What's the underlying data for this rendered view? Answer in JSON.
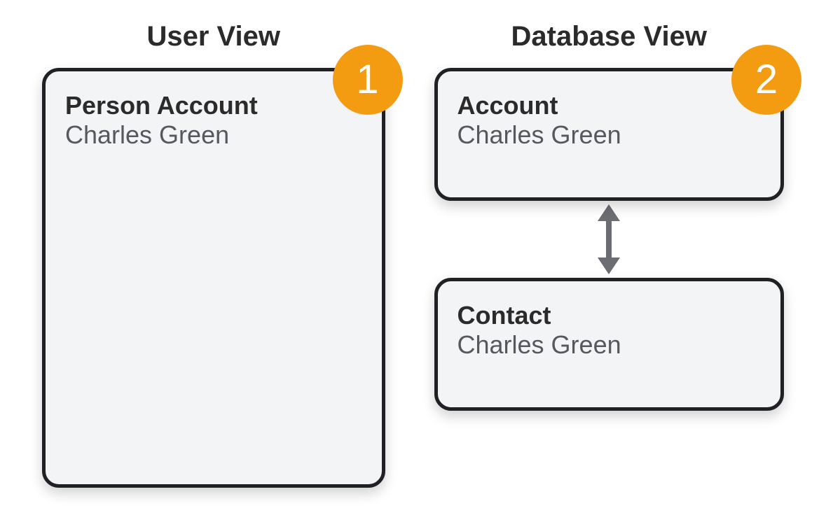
{
  "userView": {
    "header": "User View",
    "badge": "1",
    "card": {
      "title": "Person Account",
      "subtitle": "Charles Green"
    }
  },
  "databaseView": {
    "header": "Database View",
    "badge": "2",
    "account": {
      "title": "Account",
      "subtitle": "Charles Green"
    },
    "contact": {
      "title": "Contact",
      "subtitle": "Charles Green"
    }
  },
  "colors": {
    "badge": "#f39c12",
    "border": "#202125",
    "cardBg": "#f3f4f6",
    "arrow": "#6b6d72"
  }
}
